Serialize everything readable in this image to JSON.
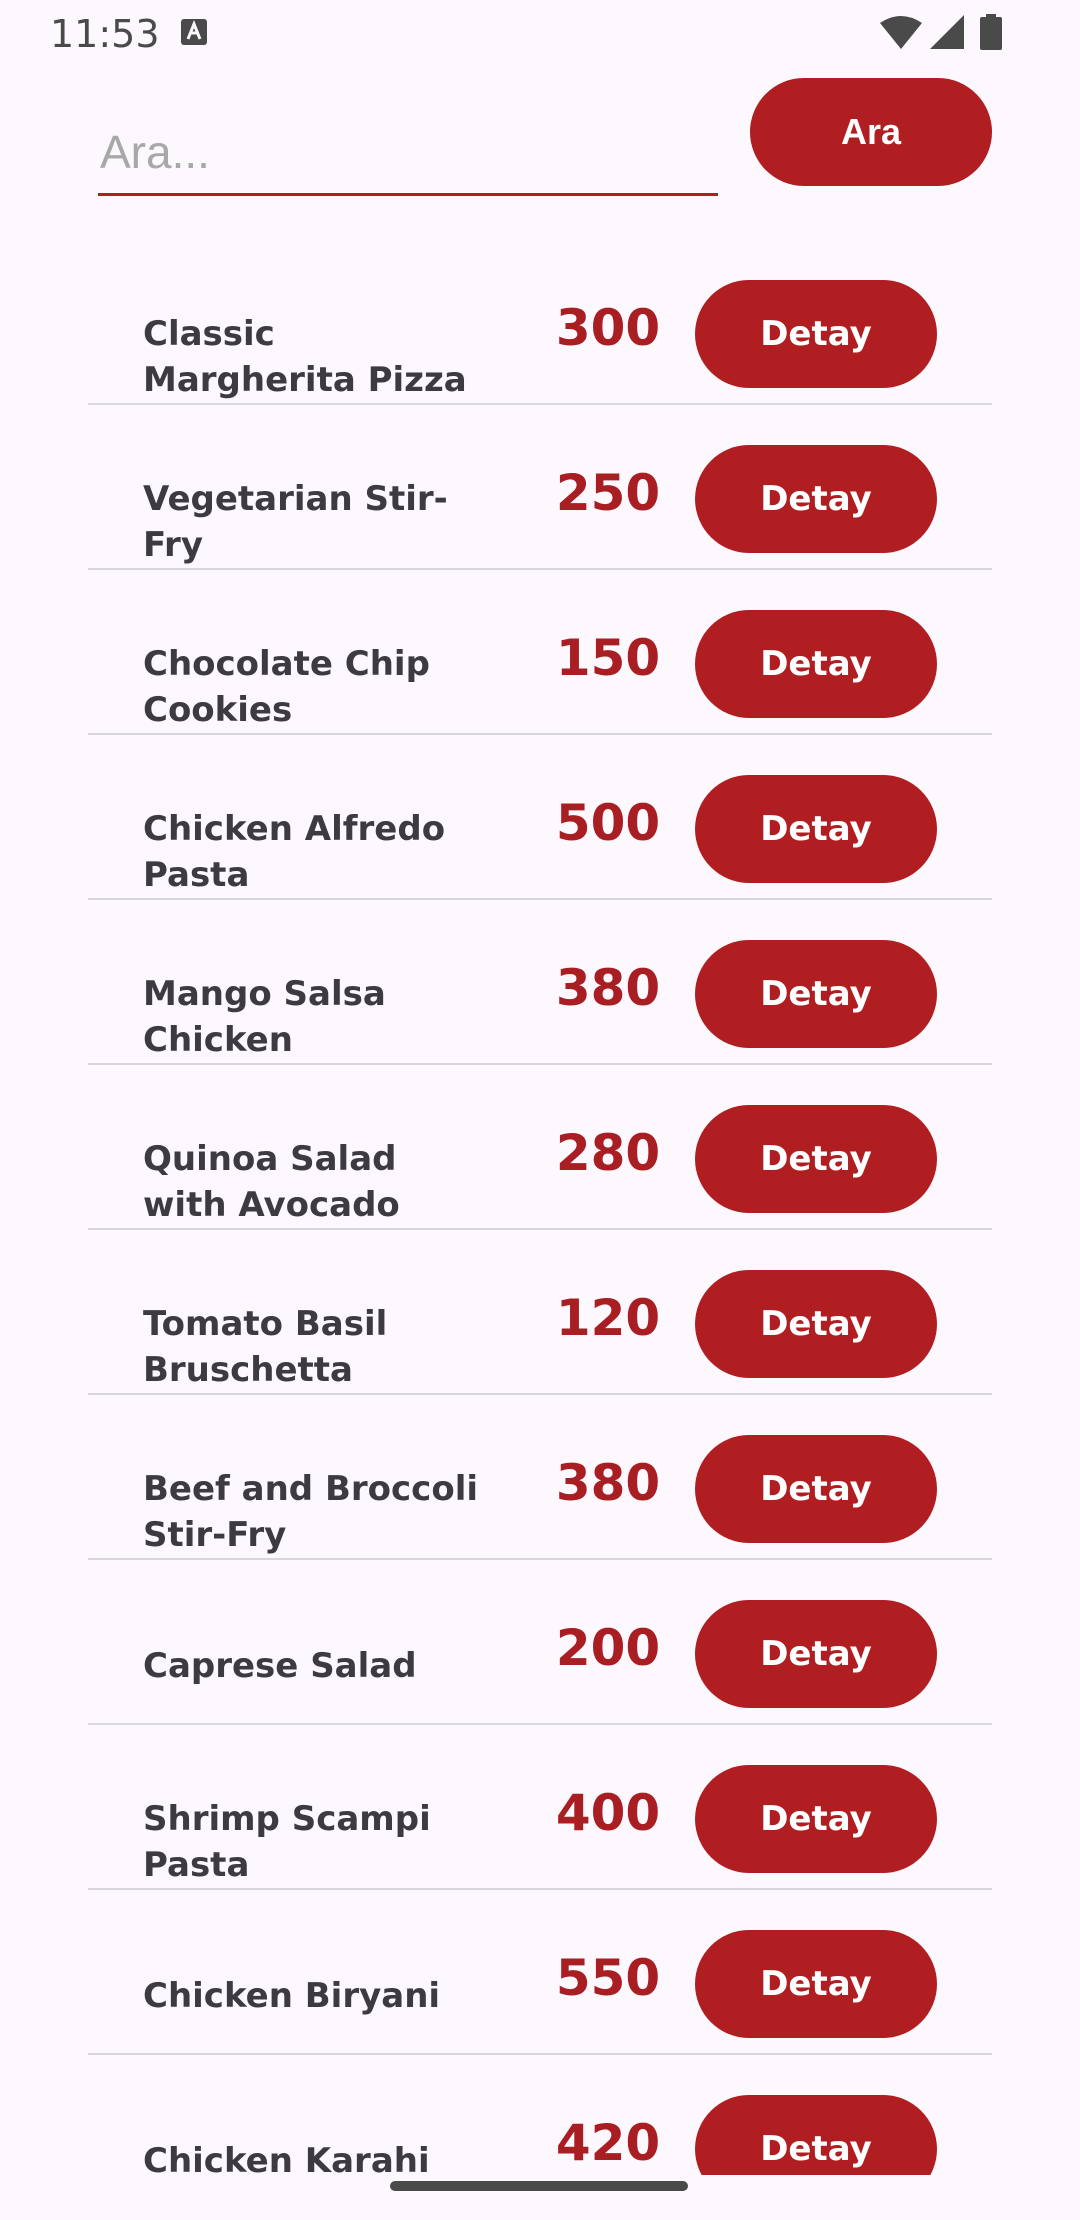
{
  "status_bar": {
    "time": "11:53",
    "icons": [
      "keyboard-a-icon",
      "wifi-icon",
      "signal-icon",
      "battery-icon"
    ]
  },
  "search": {
    "placeholder": "Ara...",
    "value": "",
    "button_label": "Ara"
  },
  "colors": {
    "accent": "#b01e22",
    "price": "#a81e22",
    "background": "#fcf8fd"
  },
  "recipes": [
    {
      "name": "Classic Margherita Pizza",
      "price": "300",
      "button": "Detay"
    },
    {
      "name": "Vegetarian Stir-Fry",
      "price": "250",
      "button": "Detay"
    },
    {
      "name": "Chocolate Chip Cookies",
      "price": "150",
      "button": "Detay"
    },
    {
      "name": "Chicken Alfredo Pasta",
      "price": "500",
      "button": "Detay"
    },
    {
      "name": "Mango Salsa Chicken",
      "price": "380",
      "button": "Detay"
    },
    {
      "name": "Quinoa Salad with Avocado",
      "price": "280",
      "button": "Detay"
    },
    {
      "name": "Tomato Basil Bruschetta",
      "price": "120",
      "button": "Detay"
    },
    {
      "name": "Beef and Broccoli Stir-Fry",
      "price": "380",
      "button": "Detay"
    },
    {
      "name": "Caprese Salad",
      "price": "200",
      "button": "Detay"
    },
    {
      "name": "Shrimp Scampi Pasta",
      "price": "400",
      "button": "Detay"
    },
    {
      "name": "Chicken Biryani",
      "price": "550",
      "button": "Detay"
    },
    {
      "name": "Chicken Karahi",
      "price": "420",
      "button": "Detay"
    }
  ]
}
